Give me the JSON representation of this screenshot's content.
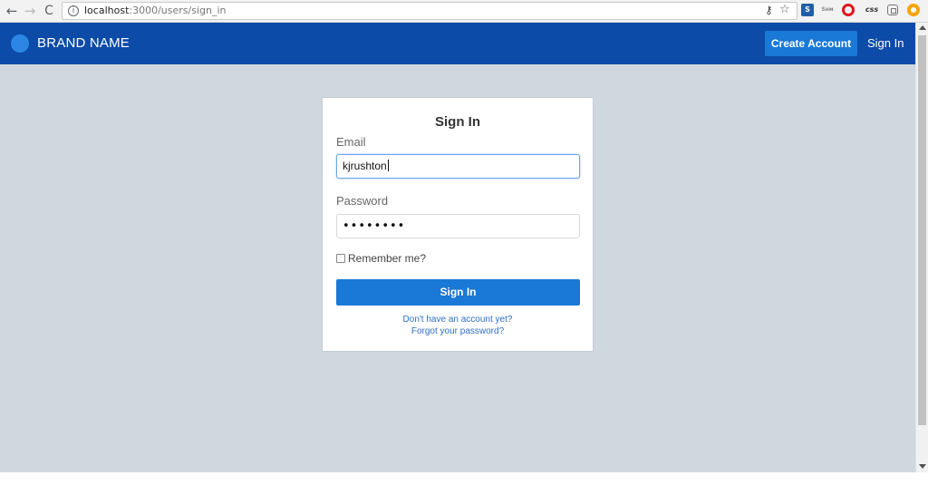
{
  "browser": {
    "url_host": "localhost",
    "url_rest": ":3000/users/sign_in",
    "back_glyph": "←",
    "forward_glyph": "→",
    "reload_glyph": "C",
    "info_glyph": "i",
    "key_glyph": "🔑",
    "star_glyph": "☆",
    "extensions": [
      {
        "name": "s-extension-icon",
        "label": "S"
      },
      {
        "name": "screenshot-extension-icon",
        "label": "Sᴵᴹ"
      },
      {
        "name": "opera-extension-icon",
        "label": ""
      },
      {
        "name": "css-extension-icon",
        "label": "css"
      },
      {
        "name": "window-extension-icon",
        "label": ""
      },
      {
        "name": "orange-extension-icon",
        "label": ""
      }
    ]
  },
  "header": {
    "brand_name": "BRAND NAME",
    "create_account_label": "Create Account",
    "sign_in_label": "Sign In",
    "brand_color": "#0c4ba7",
    "accent_color": "#1a78d6"
  },
  "form": {
    "title": "Sign In",
    "email_label": "Email",
    "email_value": "kjrushton",
    "password_label": "Password",
    "password_value": "••••••••",
    "remember_label": "Remember me?",
    "remember_checked": false,
    "submit_label": "Sign In",
    "signup_link": "Don't have an account yet?",
    "forgot_link": "Forgot your password?"
  }
}
